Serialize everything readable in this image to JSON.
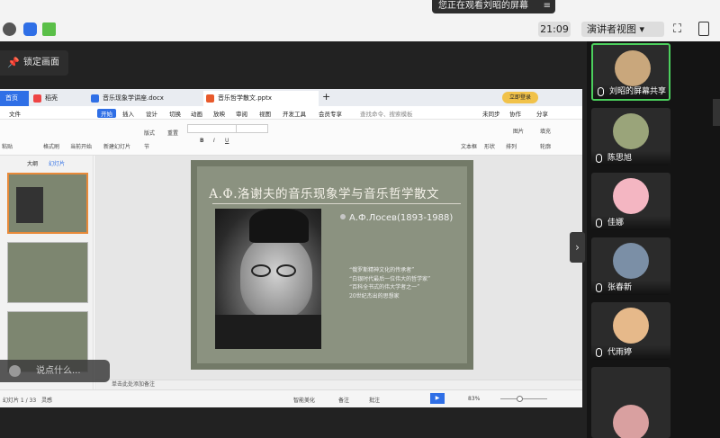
{
  "meeting": {
    "share_banner": "您正在观看刘昭的屏幕",
    "lock_label": "锁定画面",
    "clock": "21:09",
    "presenter_view": "演讲者视图",
    "comment_placeholder": "说点什么..."
  },
  "wps": {
    "tabs": [
      "首页",
      "稻壳",
      "音乐现象学讲座.docx",
      "音乐哲学散文.pptx"
    ],
    "login_btn": "立即登录",
    "menu": [
      "文件",
      "开始",
      "插入",
      "设计",
      "切换",
      "动画",
      "放映",
      "审阅",
      "视图",
      "开发工具",
      "会员专享",
      "查找命令、搜索模板",
      "未同步",
      "协作",
      "分享"
    ],
    "ribbon": [
      "粘贴",
      "格式刷",
      "当前开始",
      "新建幻灯片",
      "版式",
      "节",
      "重置",
      "文本框",
      "形状",
      "排列",
      "图片",
      "填充",
      "轮廓"
    ],
    "left_tabs": [
      "大纲",
      "幻灯片"
    ],
    "notes_placeholder": "单击此处添加备注",
    "status": {
      "slide_count": "幻灯片 1 / 33",
      "theme": "灵感",
      "smart_beauty": "智能美化",
      "notes": "备注",
      "comments": "批注",
      "zoom": "83%"
    }
  },
  "slide": {
    "title": "А.Ф.洛谢夫的音乐现象学与音乐哲学散文",
    "author": "А.Ф.Лосев(1893-1988)",
    "quotes": [
      "“俄罗斯精神文化的传承者”",
      "“白银时代最后一位伟大的哲学家”",
      "“百科全书式的伟大学者之一”",
      "20世纪杰出的思想家"
    ]
  },
  "participants": [
    {
      "name": "刘昭的屏幕共享",
      "active": true,
      "avatar_color": "#c9a77c"
    },
    {
      "name": "陈思旭",
      "active": false,
      "avatar_color": "#9aa47a"
    },
    {
      "name": "佳娜",
      "active": false,
      "avatar_color": "#f4b6c2"
    },
    {
      "name": "张春新",
      "active": false,
      "avatar_color": "#7b8fa6"
    },
    {
      "name": "代雨婷",
      "active": false,
      "avatar_color": "#e6b98a"
    },
    {
      "name": "",
      "active": false,
      "avatar_color": "#d9a0a0"
    }
  ],
  "colors": {
    "accent": "#2f6fe6",
    "wps_tab_active": "#ffffff",
    "slide_bg": "#737a68"
  }
}
